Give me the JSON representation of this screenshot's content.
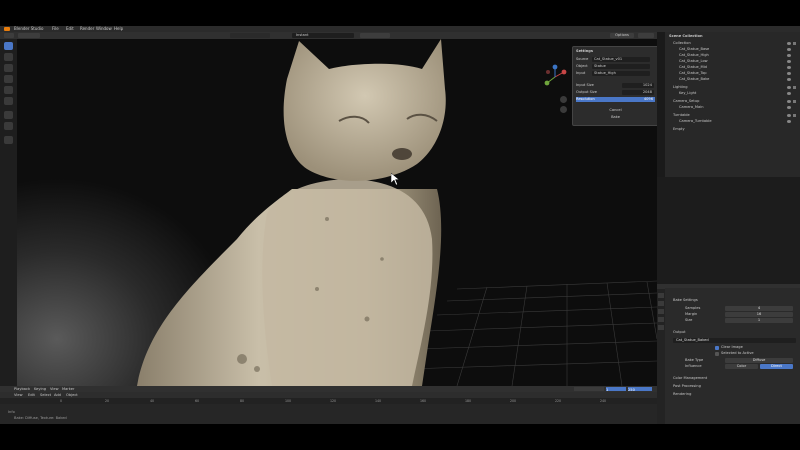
{
  "menubar": {
    "items": [
      "Blender Studio",
      "File",
      "Edit",
      "Render",
      "Window",
      "Help"
    ]
  },
  "viewport_header": {
    "search_value": "Instant",
    "shading_label": "Options"
  },
  "popup": {
    "title": "Settings",
    "rows": [
      {
        "label": "Source",
        "value": "Cat_Statue_v01"
      },
      {
        "label": "Object",
        "value": "Statue"
      },
      {
        "label": "Input",
        "value": "Statue_High"
      }
    ],
    "rows2": [
      {
        "label": "Input Size",
        "value": "1024"
      },
      {
        "label": "Output Size",
        "value": "2048"
      },
      {
        "label": "Resolution",
        "value": "4096"
      }
    ],
    "btn1": "Cancel",
    "btn2": "Bake"
  },
  "outliner": {
    "title": "Scene Collection",
    "items": [
      "Collection",
      "Cat_Statue_Base",
      "Cat_Statue_High",
      "Cat_Statue_Low",
      "Cat_Statue_Mid",
      "Cat_Statue_Top",
      "Cat_Statue_Bake",
      "Lighting",
      "Key_Light",
      "Camera_Setup",
      "Camera_Main",
      "Turntable",
      "Camera_Turntable",
      "Empty"
    ]
  },
  "properties": {
    "section_bake": "Bake Settings",
    "fields": [
      {
        "label": "Samples",
        "value": "4"
      },
      {
        "label": "Margin",
        "value": "16"
      },
      {
        "label": "Size",
        "value": "1"
      }
    ],
    "section_output": "Output",
    "output_name": "Cat_Statue_Baked",
    "checkbox1": "Clear Image",
    "checkbox2": "Selected to Active",
    "type_label": "Bake Type",
    "type_value": "Diffuse",
    "influence_label": "Influence",
    "influence_a": "Color",
    "influence_b": "Direct",
    "section3": "Color Management",
    "section4": "Post Processing",
    "section5": "Rendering"
  },
  "timeline": {
    "header": [
      "Playback",
      "Keying",
      "View",
      "Marker"
    ],
    "ctrl": [
      "View",
      "Edit",
      "Select",
      "Add",
      "Object"
    ],
    "frame_start": "1",
    "frame_end": "250",
    "ticks": [
      "0",
      "20",
      "40",
      "60",
      "80",
      "100",
      "120",
      "140",
      "160",
      "180",
      "200",
      "220",
      "240"
    ],
    "log_lines": [
      "Info",
      "Bake: Diffuse, Texture: Baked"
    ]
  },
  "colors": {
    "accent": "#4a77c7",
    "panel": "#282828",
    "viewport": "#111111"
  }
}
